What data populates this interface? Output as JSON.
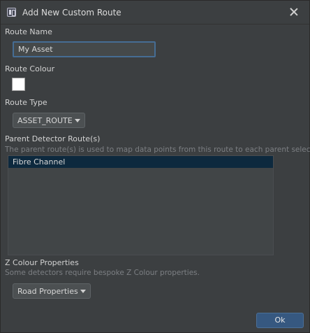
{
  "window": {
    "title": "Add New Custom Route"
  },
  "route_name": {
    "label": "Route Name",
    "value": "My Asset"
  },
  "route_colour": {
    "label": "Route Colour",
    "color": "#ffffff"
  },
  "route_type": {
    "label": "Route Type",
    "selected": "ASSET_ROUTE"
  },
  "parent_routes": {
    "label": "Parent Detector Route(s)",
    "hint": "The parent route(s) is used to map data points from this route to each parent selected",
    "items": [
      {
        "label": "Fibre Channel",
        "selected": true
      }
    ]
  },
  "z_colour": {
    "label": "Z Colour Properties",
    "hint": "Some detectors require bespoke Z Colour properties.",
    "selected": "Road Properties"
  },
  "footer": {
    "ok_label": "Ok"
  },
  "colors": {
    "dialog_bg": "#3c3f41",
    "selection": "#0d293e",
    "accent": "#365880",
    "focus_border": "#466d94"
  }
}
